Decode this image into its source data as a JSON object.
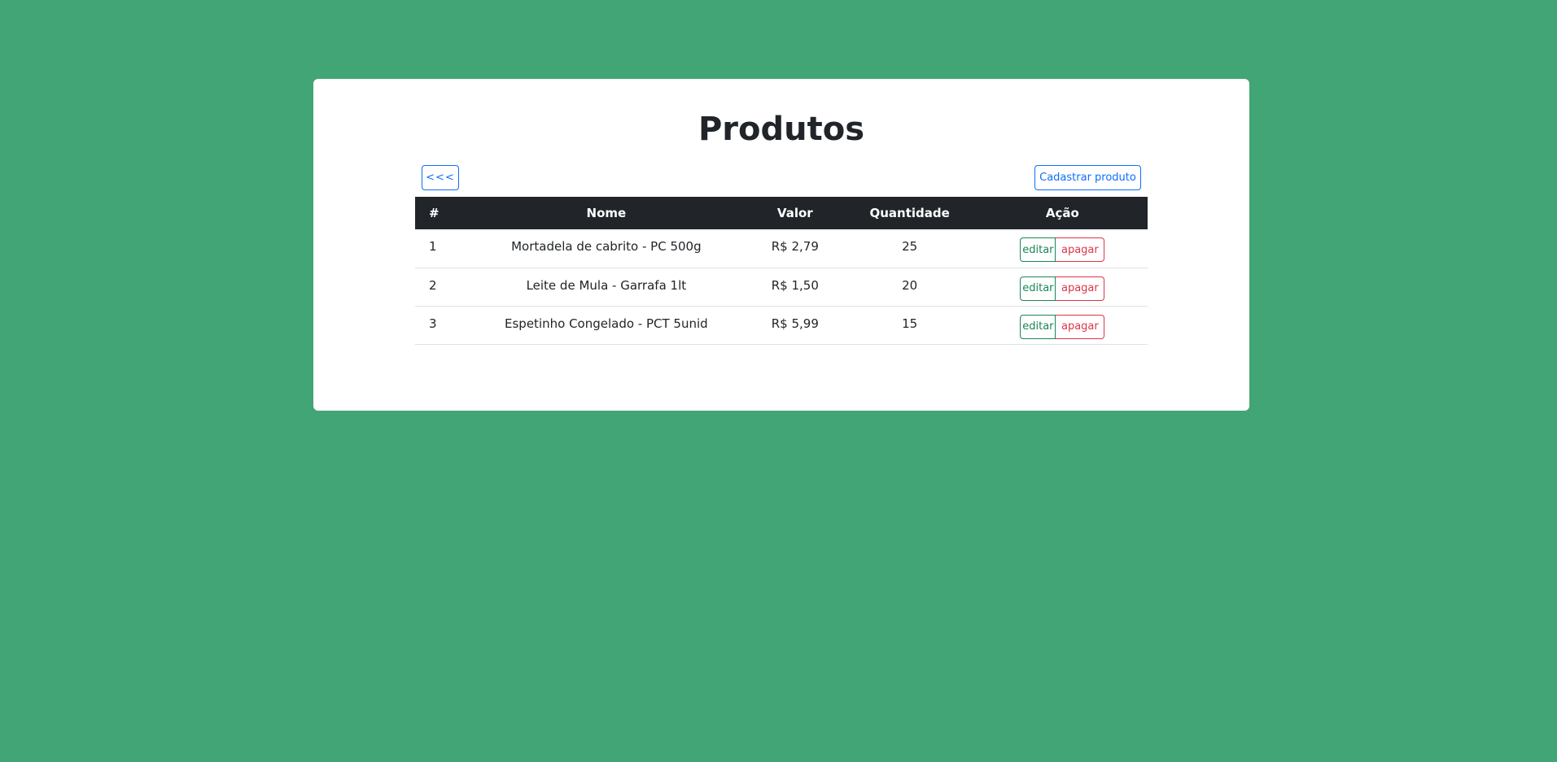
{
  "page": {
    "title": "Produtos"
  },
  "toolbar": {
    "back_label": "<<<",
    "add_label": "Cadastrar produto"
  },
  "table": {
    "headers": [
      "#",
      "Nome",
      "Valor",
      "Quantidade",
      "Ação"
    ],
    "rows": [
      {
        "id": "1",
        "nome": "Mortadela de cabrito - PC 500g",
        "valor": "R$ 2,79",
        "quantidade": "25",
        "edit": "editar",
        "delete": "apagar"
      },
      {
        "id": "2",
        "nome": "Leite de Mula - Garrafa 1lt",
        "valor": "R$ 1,50",
        "quantidade": "20",
        "edit": "editar",
        "delete": "apagar"
      },
      {
        "id": "3",
        "nome": "Espetinho Congelado - PCT 5unid",
        "valor": "R$ 5,99",
        "quantidade": "15",
        "edit": "editar",
        "delete": "apagar"
      }
    ]
  },
  "colors": {
    "background": "#41a575",
    "header_bg": "#212529",
    "primary": "#0d6efd",
    "success": "#198754",
    "danger": "#dc3545"
  }
}
